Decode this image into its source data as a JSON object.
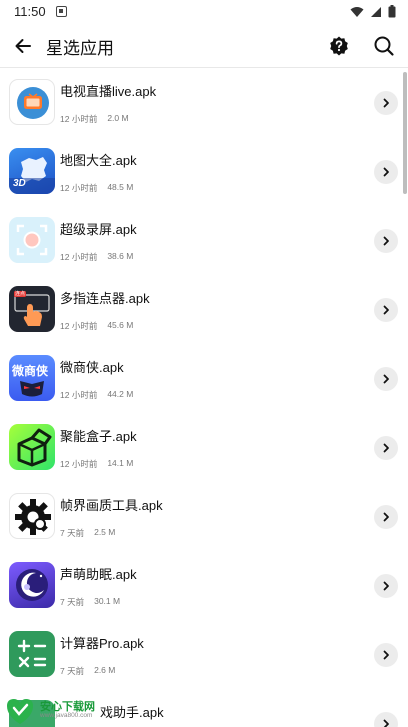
{
  "status_bar": {
    "time": "11:50"
  },
  "header": {
    "title": "星选应用",
    "back_icon": "arrow-left-icon",
    "help_icon": "help-icon",
    "search_icon": "search-icon"
  },
  "apps": [
    {
      "name": "电视直播live.apk",
      "time": "12 小时前",
      "size": "2.0 M"
    },
    {
      "name": "地图大全.apk",
      "time": "12 小时前",
      "size": "48.5 M"
    },
    {
      "name": "超级录屏.apk",
      "time": "12 小时前",
      "size": "38.6 M"
    },
    {
      "name": "多指连点器.apk",
      "time": "12 小时前",
      "size": "45.6 M"
    },
    {
      "name": "微商侠.apk",
      "time": "12 小时前",
      "size": "44.2 M"
    },
    {
      "name": "聚能盒子.apk",
      "time": "12 小时前",
      "size": "14.1 M"
    },
    {
      "name": "帧界画质工具.apk",
      "time": "7 天前",
      "size": "2.5 M"
    },
    {
      "name": "声萌助眠.apk",
      "time": "7 天前",
      "size": "30.1 M"
    },
    {
      "name": "计算器Pro.apk",
      "time": "7 天前",
      "size": "2.6 M"
    },
    {
      "name": "戏助手.apk",
      "time": "",
      "size": ""
    }
  ],
  "icon_texts": {
    "map_3d": "3D",
    "weishangxia": "微商侠",
    "multitap_badge": "连点"
  },
  "watermark": {
    "brand": "安心下载网",
    "url": "www.java800.com"
  }
}
